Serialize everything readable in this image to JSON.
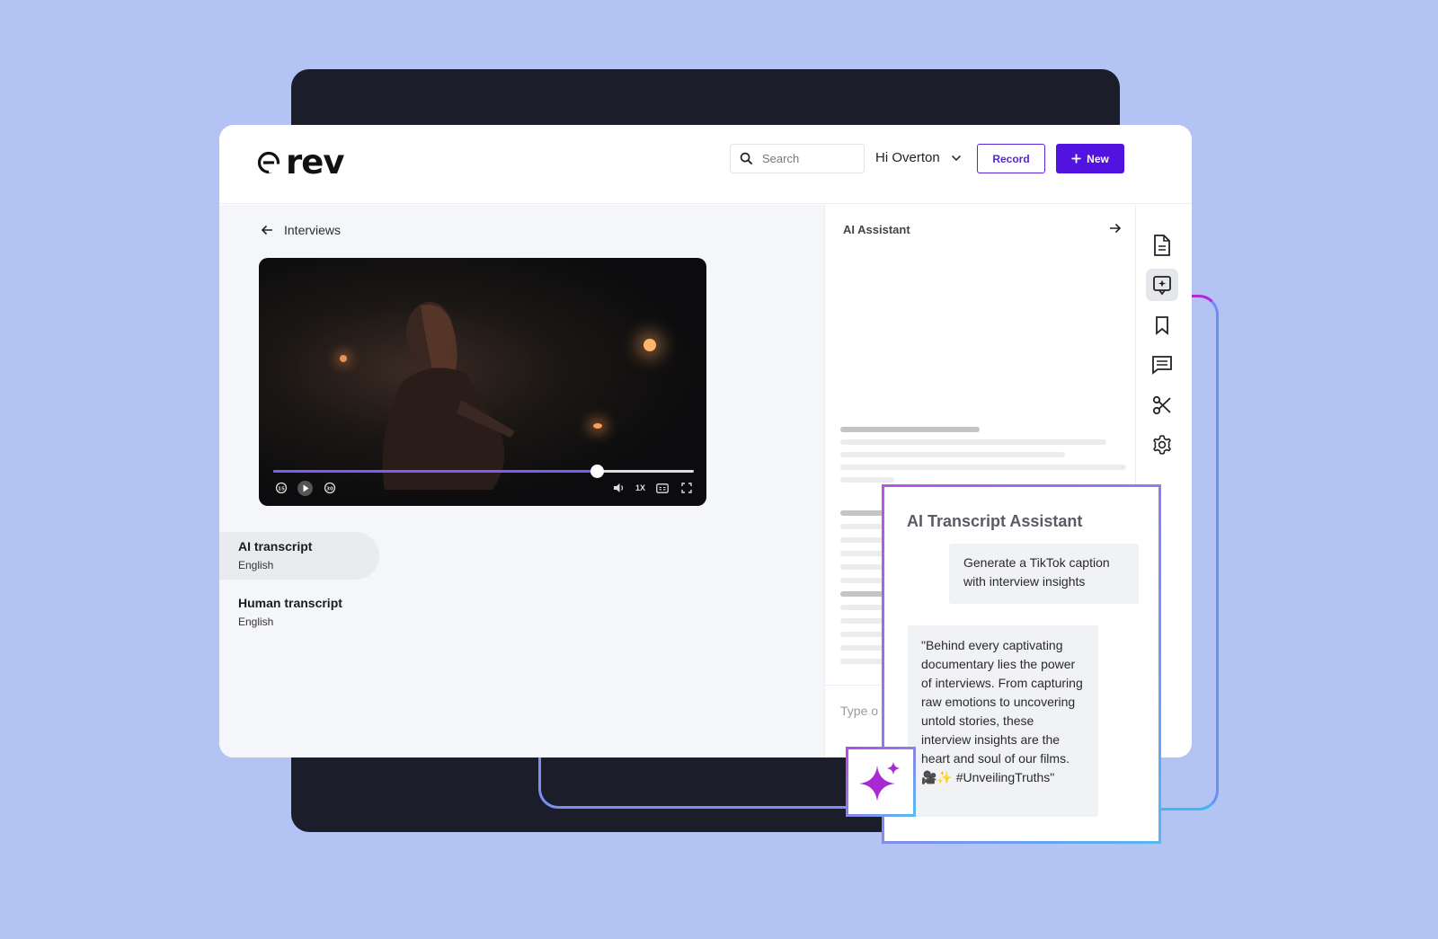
{
  "app": {
    "logo_text": "rev"
  },
  "header": {
    "search_placeholder": "Search",
    "greeting": "Hi Overton",
    "record_label": "Record",
    "new_label": "New"
  },
  "nav": {
    "back_label": "Interviews"
  },
  "player": {
    "progress": 0.77,
    "speed_label": "1X"
  },
  "transcripts": [
    {
      "title": "AI transcript",
      "language": "English",
      "active": true
    },
    {
      "title": "Human transcript",
      "language": "English",
      "active": false
    }
  ],
  "assistant": {
    "panel_title": "AI Assistant",
    "input_placeholder": "Type o",
    "card_title": "AI Transcript Assistant",
    "user_message": "Generate a TikTok caption with interview insights",
    "ai_reply": "\"Behind every captivating documentary lies the power of interviews. From capturing raw emotions to uncovering untold stories, these interview insights are the heart and soul of our films. 🎥✨ #UnveilingTruths\""
  },
  "tools": [
    "document-icon",
    "ai-note-icon",
    "bookmark-icon",
    "comment-icon",
    "scissors-icon",
    "gear-icon"
  ],
  "colors": {
    "background": "#b3c3f4",
    "dark_panel": "#1c1d2b",
    "brand_purple": "#5212e0",
    "progress": "#7c5cf2",
    "sparkle": "#a82ad0"
  }
}
